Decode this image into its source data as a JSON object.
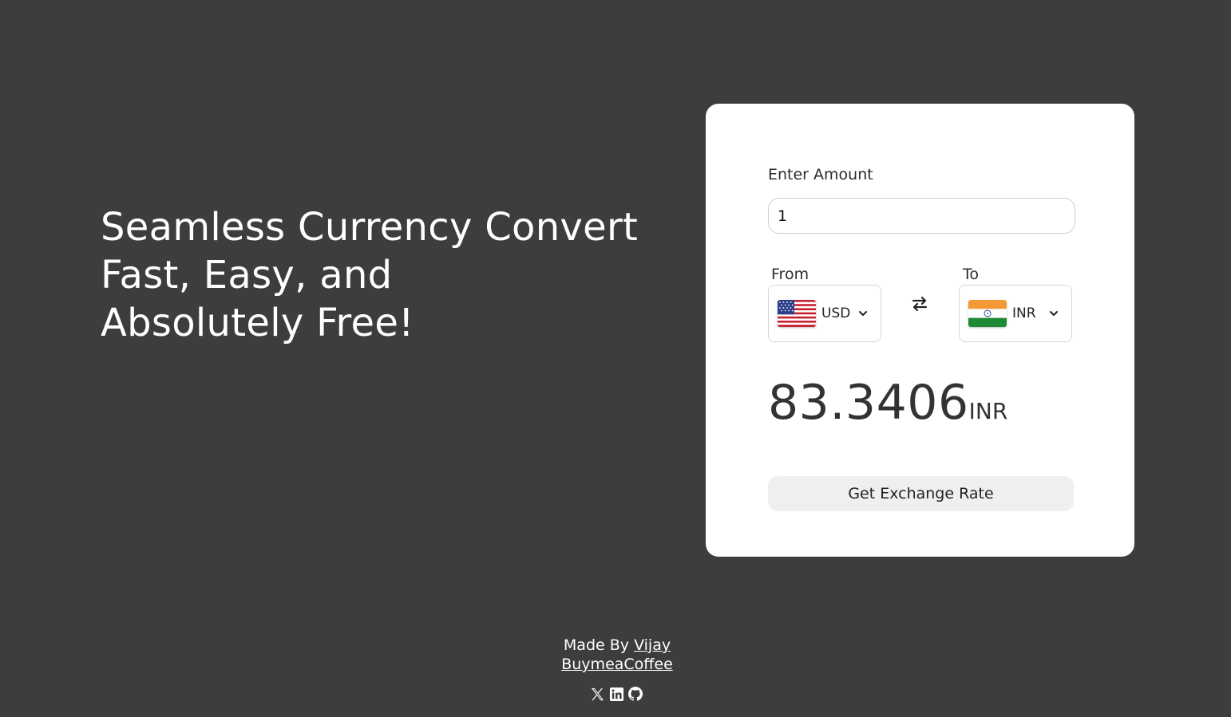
{
  "hero": {
    "line1": "Seamless Currency Convert",
    "line2": "Fast, Easy, and",
    "line3": "Absolutely Free!"
  },
  "converter": {
    "amount_label": "Enter Amount",
    "amount_value": "1",
    "from_label": "From",
    "to_label": "To",
    "from_currency": "USD",
    "to_currency": "INR",
    "swap_icon": "swap-arrows-icon",
    "result_value": "83.3406",
    "result_currency": "INR",
    "button_label": "Get Exchange Rate"
  },
  "footer": {
    "made_by_prefix": "Made By ",
    "author": "Vijay",
    "coffee_link": "BuymeaCoffee",
    "socials": [
      "x-icon",
      "linkedin-icon",
      "github-icon"
    ]
  },
  "colors": {
    "background": "#3d3d3d",
    "card": "#ffffff",
    "button": "#efefef"
  }
}
